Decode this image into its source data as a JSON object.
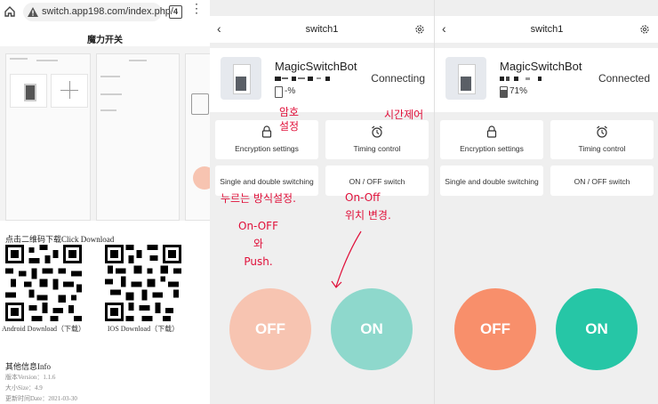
{
  "browser": {
    "url": "switch.app198.com/index.php/",
    "tab_count": "4",
    "page_title": "魔力开关",
    "download_label": "点击二维码下载Click Download",
    "android_caption": "Android Download（下载）",
    "ios_caption": "IOS Download（下载）",
    "info_title": "其他信息Info",
    "info_lines": [
      "版本Version：1.1.6",
      "大小Size：4.9",
      "更新时间Date：2021-03-30"
    ]
  },
  "app_left": {
    "title": "switch1",
    "device_name": "MagicSwitchBot",
    "battery": "-%",
    "status": "Connecting",
    "tiles": [
      "Encryption settings",
      "Timing control",
      "Single and double switching",
      "ON / OFF switch"
    ],
    "off_label": "OFF",
    "on_label": "ON",
    "annotations": {
      "password": "암호\n설정",
      "timer": "시간제어",
      "press_mode": "누르는 방식설정.",
      "onoff_push": "On-OFF\n와\nPush.",
      "onoff_position": "On-Off\n위치 변경."
    }
  },
  "app_right": {
    "title": "switch1",
    "device_name": "MagicSwitchBot",
    "battery": "71%",
    "status": "Connected",
    "tiles": [
      "Encryption settings",
      "Timing control",
      "Single and double switching",
      "ON / OFF switch"
    ],
    "off_label": "OFF",
    "on_label": "ON"
  },
  "colors": {
    "off_faded": "#f7c4b1",
    "on_faded": "#8ed8cc",
    "off": "#f88f6b",
    "on": "#26c6a6",
    "annotation": "#e0103a"
  }
}
